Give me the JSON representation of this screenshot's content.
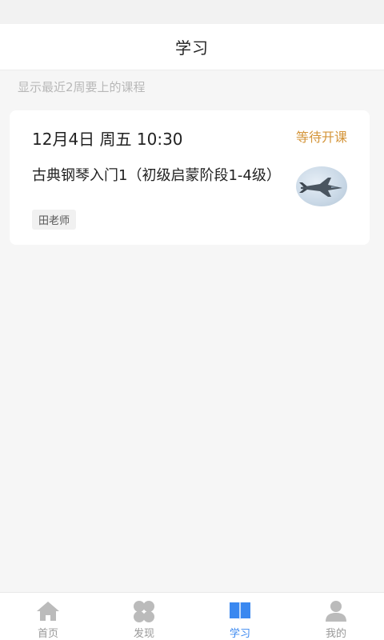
{
  "header": {
    "title": "学习"
  },
  "hint": "显示最近2周要上的课程",
  "course_card": {
    "time": "12月4日 周五 10:30",
    "status": "等待开课",
    "course_name": "古典钢琴入门1（初级启蒙阶段1-4级）",
    "teacher": "田老师",
    "thumbnail": "fighter-jet-image"
  },
  "tab_bar": {
    "items": [
      {
        "label": "首页",
        "icon": "home-icon",
        "active": false
      },
      {
        "label": "发现",
        "icon": "discover-icon",
        "active": false
      },
      {
        "label": "学习",
        "icon": "book-icon",
        "active": true
      },
      {
        "label": "我的",
        "icon": "profile-icon",
        "active": false
      }
    ]
  },
  "colors": {
    "accent": "#3a88f0",
    "status": "#d4953a",
    "inactive": "#bbbbbb"
  }
}
